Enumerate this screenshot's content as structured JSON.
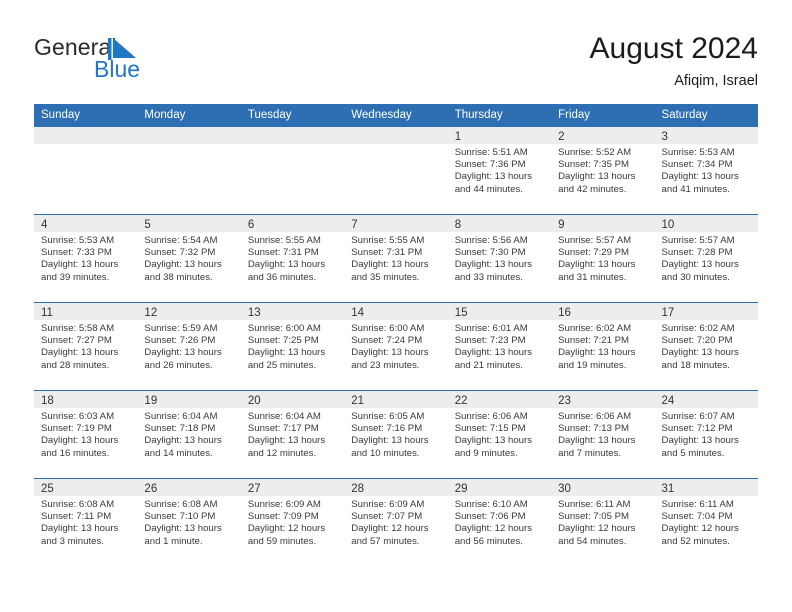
{
  "brand": {
    "name_part1": "General",
    "name_part2": "Blue",
    "mark": "triangle-flag-icon",
    "accent_color": "#2077c4"
  },
  "header": {
    "title": "August 2024",
    "subtitle": "Afiqim, Israel"
  },
  "theme": {
    "header_blue": "#2d6fb2",
    "day_band_gray": "#ededed",
    "text_color": "#3a3a3a"
  },
  "weekdays": [
    "Sunday",
    "Monday",
    "Tuesday",
    "Wednesday",
    "Thursday",
    "Friday",
    "Saturday"
  ],
  "weeks": [
    [
      {
        "day": "",
        "sunrise": "",
        "sunset": "",
        "daylight1": "",
        "daylight2": ""
      },
      {
        "day": "",
        "sunrise": "",
        "sunset": "",
        "daylight1": "",
        "daylight2": ""
      },
      {
        "day": "",
        "sunrise": "",
        "sunset": "",
        "daylight1": "",
        "daylight2": ""
      },
      {
        "day": "",
        "sunrise": "",
        "sunset": "",
        "daylight1": "",
        "daylight2": ""
      },
      {
        "day": "1",
        "sunrise": "Sunrise: 5:51 AM",
        "sunset": "Sunset: 7:36 PM",
        "daylight1": "Daylight: 13 hours",
        "daylight2": "and 44 minutes."
      },
      {
        "day": "2",
        "sunrise": "Sunrise: 5:52 AM",
        "sunset": "Sunset: 7:35 PM",
        "daylight1": "Daylight: 13 hours",
        "daylight2": "and 42 minutes."
      },
      {
        "day": "3",
        "sunrise": "Sunrise: 5:53 AM",
        "sunset": "Sunset: 7:34 PM",
        "daylight1": "Daylight: 13 hours",
        "daylight2": "and 41 minutes."
      }
    ],
    [
      {
        "day": "4",
        "sunrise": "Sunrise: 5:53 AM",
        "sunset": "Sunset: 7:33 PM",
        "daylight1": "Daylight: 13 hours",
        "daylight2": "and 39 minutes."
      },
      {
        "day": "5",
        "sunrise": "Sunrise: 5:54 AM",
        "sunset": "Sunset: 7:32 PM",
        "daylight1": "Daylight: 13 hours",
        "daylight2": "and 38 minutes."
      },
      {
        "day": "6",
        "sunrise": "Sunrise: 5:55 AM",
        "sunset": "Sunset: 7:31 PM",
        "daylight1": "Daylight: 13 hours",
        "daylight2": "and 36 minutes."
      },
      {
        "day": "7",
        "sunrise": "Sunrise: 5:55 AM",
        "sunset": "Sunset: 7:31 PM",
        "daylight1": "Daylight: 13 hours",
        "daylight2": "and 35 minutes."
      },
      {
        "day": "8",
        "sunrise": "Sunrise: 5:56 AM",
        "sunset": "Sunset: 7:30 PM",
        "daylight1": "Daylight: 13 hours",
        "daylight2": "and 33 minutes."
      },
      {
        "day": "9",
        "sunrise": "Sunrise: 5:57 AM",
        "sunset": "Sunset: 7:29 PM",
        "daylight1": "Daylight: 13 hours",
        "daylight2": "and 31 minutes."
      },
      {
        "day": "10",
        "sunrise": "Sunrise: 5:57 AM",
        "sunset": "Sunset: 7:28 PM",
        "daylight1": "Daylight: 13 hours",
        "daylight2": "and 30 minutes."
      }
    ],
    [
      {
        "day": "11",
        "sunrise": "Sunrise: 5:58 AM",
        "sunset": "Sunset: 7:27 PM",
        "daylight1": "Daylight: 13 hours",
        "daylight2": "and 28 minutes."
      },
      {
        "day": "12",
        "sunrise": "Sunrise: 5:59 AM",
        "sunset": "Sunset: 7:26 PM",
        "daylight1": "Daylight: 13 hours",
        "daylight2": "and 26 minutes."
      },
      {
        "day": "13",
        "sunrise": "Sunrise: 6:00 AM",
        "sunset": "Sunset: 7:25 PM",
        "daylight1": "Daylight: 13 hours",
        "daylight2": "and 25 minutes."
      },
      {
        "day": "14",
        "sunrise": "Sunrise: 6:00 AM",
        "sunset": "Sunset: 7:24 PM",
        "daylight1": "Daylight: 13 hours",
        "daylight2": "and 23 minutes."
      },
      {
        "day": "15",
        "sunrise": "Sunrise: 6:01 AM",
        "sunset": "Sunset: 7:23 PM",
        "daylight1": "Daylight: 13 hours",
        "daylight2": "and 21 minutes."
      },
      {
        "day": "16",
        "sunrise": "Sunrise: 6:02 AM",
        "sunset": "Sunset: 7:21 PM",
        "daylight1": "Daylight: 13 hours",
        "daylight2": "and 19 minutes."
      },
      {
        "day": "17",
        "sunrise": "Sunrise: 6:02 AM",
        "sunset": "Sunset: 7:20 PM",
        "daylight1": "Daylight: 13 hours",
        "daylight2": "and 18 minutes."
      }
    ],
    [
      {
        "day": "18",
        "sunrise": "Sunrise: 6:03 AM",
        "sunset": "Sunset: 7:19 PM",
        "daylight1": "Daylight: 13 hours",
        "daylight2": "and 16 minutes."
      },
      {
        "day": "19",
        "sunrise": "Sunrise: 6:04 AM",
        "sunset": "Sunset: 7:18 PM",
        "daylight1": "Daylight: 13 hours",
        "daylight2": "and 14 minutes."
      },
      {
        "day": "20",
        "sunrise": "Sunrise: 6:04 AM",
        "sunset": "Sunset: 7:17 PM",
        "daylight1": "Daylight: 13 hours",
        "daylight2": "and 12 minutes."
      },
      {
        "day": "21",
        "sunrise": "Sunrise: 6:05 AM",
        "sunset": "Sunset: 7:16 PM",
        "daylight1": "Daylight: 13 hours",
        "daylight2": "and 10 minutes."
      },
      {
        "day": "22",
        "sunrise": "Sunrise: 6:06 AM",
        "sunset": "Sunset: 7:15 PM",
        "daylight1": "Daylight: 13 hours",
        "daylight2": "and 9 minutes."
      },
      {
        "day": "23",
        "sunrise": "Sunrise: 6:06 AM",
        "sunset": "Sunset: 7:13 PM",
        "daylight1": "Daylight: 13 hours",
        "daylight2": "and 7 minutes."
      },
      {
        "day": "24",
        "sunrise": "Sunrise: 6:07 AM",
        "sunset": "Sunset: 7:12 PM",
        "daylight1": "Daylight: 13 hours",
        "daylight2": "and 5 minutes."
      }
    ],
    [
      {
        "day": "25",
        "sunrise": "Sunrise: 6:08 AM",
        "sunset": "Sunset: 7:11 PM",
        "daylight1": "Daylight: 13 hours",
        "daylight2": "and 3 minutes."
      },
      {
        "day": "26",
        "sunrise": "Sunrise: 6:08 AM",
        "sunset": "Sunset: 7:10 PM",
        "daylight1": "Daylight: 13 hours",
        "daylight2": "and 1 minute."
      },
      {
        "day": "27",
        "sunrise": "Sunrise: 6:09 AM",
        "sunset": "Sunset: 7:09 PM",
        "daylight1": "Daylight: 12 hours",
        "daylight2": "and 59 minutes."
      },
      {
        "day": "28",
        "sunrise": "Sunrise: 6:09 AM",
        "sunset": "Sunset: 7:07 PM",
        "daylight1": "Daylight: 12 hours",
        "daylight2": "and 57 minutes."
      },
      {
        "day": "29",
        "sunrise": "Sunrise: 6:10 AM",
        "sunset": "Sunset: 7:06 PM",
        "daylight1": "Daylight: 12 hours",
        "daylight2": "and 56 minutes."
      },
      {
        "day": "30",
        "sunrise": "Sunrise: 6:11 AM",
        "sunset": "Sunset: 7:05 PM",
        "daylight1": "Daylight: 12 hours",
        "daylight2": "and 54 minutes."
      },
      {
        "day": "31",
        "sunrise": "Sunrise: 6:11 AM",
        "sunset": "Sunset: 7:04 PM",
        "daylight1": "Daylight: 12 hours",
        "daylight2": "and 52 minutes."
      }
    ]
  ]
}
